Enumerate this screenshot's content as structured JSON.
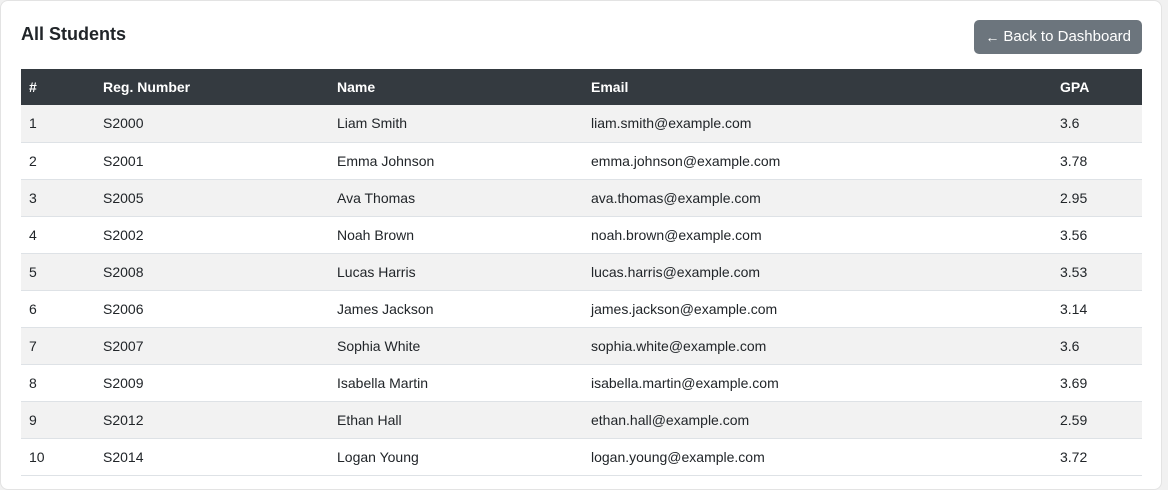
{
  "page": {
    "title": "All Students",
    "back_button": {
      "icon": "arrow-left-icon",
      "arrow": "←",
      "label": "Back to Dashboard",
      "color": "#6c757d"
    }
  },
  "table": {
    "header_color": "#343a40",
    "columns": [
      "#",
      "Reg. Number",
      "Name",
      "Email",
      "GPA"
    ],
    "rows": [
      {
        "num": "1",
        "reg": "S2000",
        "name": "Liam Smith",
        "email": "liam.smith@example.com",
        "gpa": "3.6"
      },
      {
        "num": "2",
        "reg": "S2001",
        "name": "Emma Johnson",
        "email": "emma.johnson@example.com",
        "gpa": "3.78"
      },
      {
        "num": "3",
        "reg": "S2005",
        "name": "Ava Thomas",
        "email": "ava.thomas@example.com",
        "gpa": "2.95"
      },
      {
        "num": "4",
        "reg": "S2002",
        "name": "Noah Brown",
        "email": "noah.brown@example.com",
        "gpa": "3.56"
      },
      {
        "num": "5",
        "reg": "S2008",
        "name": "Lucas Harris",
        "email": "lucas.harris@example.com",
        "gpa": "3.53"
      },
      {
        "num": "6",
        "reg": "S2006",
        "name": "James Jackson",
        "email": "james.jackson@example.com",
        "gpa": "3.14"
      },
      {
        "num": "7",
        "reg": "S2007",
        "name": "Sophia White",
        "email": "sophia.white@example.com",
        "gpa": "3.6"
      },
      {
        "num": "8",
        "reg": "S2009",
        "name": "Isabella Martin",
        "email": "isabella.martin@example.com",
        "gpa": "3.69"
      },
      {
        "num": "9",
        "reg": "S2012",
        "name": "Ethan Hall",
        "email": "ethan.hall@example.com",
        "gpa": "2.59"
      },
      {
        "num": "10",
        "reg": "S2014",
        "name": "Logan Young",
        "email": "logan.young@example.com",
        "gpa": "3.72"
      }
    ]
  }
}
